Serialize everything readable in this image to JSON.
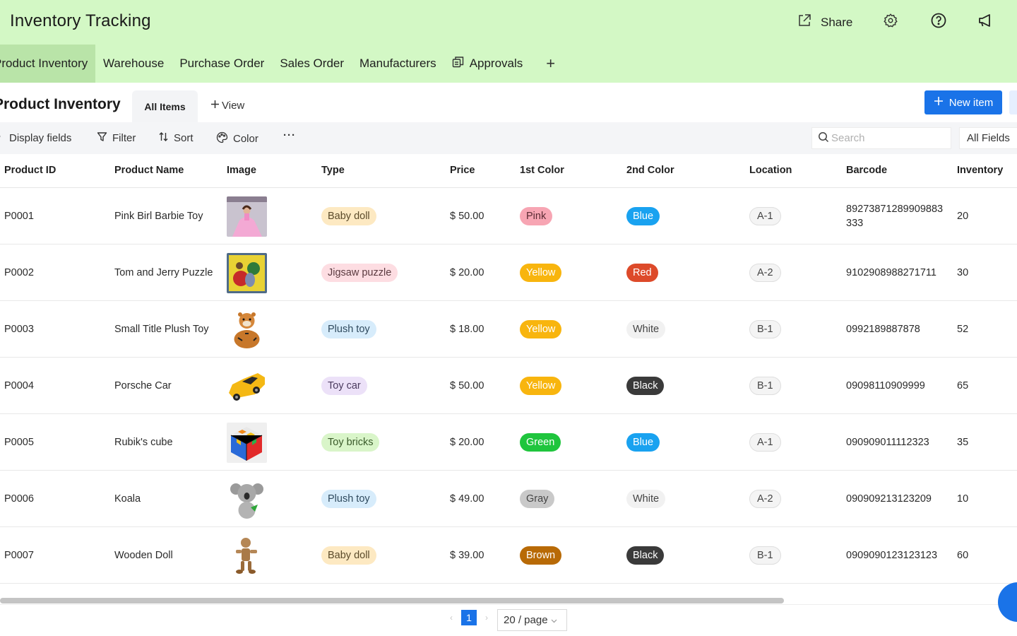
{
  "header": {
    "title": "Inventory Tracking",
    "share_label": "Share",
    "icons": [
      "share-icon",
      "gear-icon",
      "help-icon",
      "megaphone-icon"
    ]
  },
  "nav": {
    "tabs": [
      {
        "label": "Product Inventory",
        "active": true
      },
      {
        "label": "Warehouse"
      },
      {
        "label": "Purchase Order"
      },
      {
        "label": "Sales Order"
      },
      {
        "label": "Manufacturers"
      },
      {
        "label": "Approvals",
        "icon": "copy-icon"
      }
    ],
    "add_label": "+"
  },
  "view": {
    "title": "Product Inventory",
    "active_view": "All Items",
    "add_view_label": "View",
    "new_item_label": "New item"
  },
  "toolbar": {
    "display_fields": "Display fields",
    "filter": "Filter",
    "sort": "Sort",
    "color": "Color",
    "more": "···",
    "search_placeholder": "Search",
    "field_scope": "All Fields"
  },
  "table": {
    "columns": [
      "Product ID",
      "Product Name",
      "Image",
      "Type",
      "Price",
      "1st Color",
      "2nd Color",
      "Location",
      "Barcode",
      "Inventory"
    ],
    "rows": [
      {
        "id": "P0001",
        "name": "Pink Birl Barbie Toy",
        "image": "doll-photo",
        "type": "Baby doll",
        "price": "$ 50.00",
        "color1": "Pink",
        "color2": "Blue",
        "location": "A-1",
        "barcode": "89273871289909883333",
        "inventory": "20"
      },
      {
        "id": "P0002",
        "name": "Tom and Jerry Puzzle",
        "image": "puzzle-photo",
        "type": "Jigsaw puzzle",
        "price": "$ 20.00",
        "color1": "Yellow",
        "color2": "Red",
        "location": "A-2",
        "barcode": "9102908988271711",
        "inventory": "30"
      },
      {
        "id": "P0003",
        "name": "Small Title Plush Toy",
        "image": "tiger-photo",
        "type": "Plush toy",
        "price": "$ 18.00",
        "color1": "Yellow",
        "color2": "White",
        "location": "B-1",
        "barcode": "0992189887878",
        "inventory": "52"
      },
      {
        "id": "P0004",
        "name": "Porsche Car",
        "image": "car-photo",
        "type": "Toy car",
        "price": "$ 50.00",
        "color1": "Yellow",
        "color2": "Black",
        "location": "B-1",
        "barcode": "09098110909999",
        "inventory": "65"
      },
      {
        "id": "P0005",
        "name": "Rubik's cube",
        "image": "cube-photo",
        "type": "Toy bricks",
        "price": "$ 20.00",
        "color1": "Green",
        "color2": "Blue",
        "location": "A-1",
        "barcode": "090909011112323",
        "inventory": "35"
      },
      {
        "id": "P0006",
        "name": "Koala",
        "image": "koala-photo",
        "type": "Plush toy",
        "price": "$ 49.00",
        "color1": "Gray",
        "color2": "White",
        "location": "A-2",
        "barcode": "090909213123209",
        "inventory": "10"
      },
      {
        "id": "P0007",
        "name": "Wooden Doll",
        "image": "wooden-doll-photo",
        "type": "Baby doll",
        "price": "$ 39.00",
        "color1": "Brown",
        "color2": "Black",
        "location": "B-1",
        "barcode": "0909090123123123",
        "inventory": "60"
      }
    ]
  },
  "type_colors": {
    "Baby doll": {
      "bg": "#fde9c2",
      "fg": "#5a4a2a"
    },
    "Jigsaw puzzle": {
      "bg": "#fddde2",
      "fg": "#5a3a40"
    },
    "Plush toy": {
      "bg": "#d7ecfb",
      "fg": "#2f4a5e"
    },
    "Toy car": {
      "bg": "#ece1f8",
      "fg": "#4a3a5e"
    },
    "Toy bricks": {
      "bg": "#d9f5c9",
      "fg": "#3a5a2a"
    }
  },
  "color_tags": {
    "Pink": {
      "bg": "#f7a5b3",
      "fg": "#5a2a33"
    },
    "Blue": {
      "bg": "#19a2f0",
      "fg": "#ffffff"
    },
    "Yellow": {
      "bg": "#f8b50e",
      "fg": "#ffffff"
    },
    "Red": {
      "bg": "#dd4a2a",
      "fg": "#ffffff"
    },
    "White": {
      "bg": "#f1f1f1",
      "fg": "#444444"
    },
    "Black": {
      "bg": "#3a3a3a",
      "fg": "#ffffff"
    },
    "Green": {
      "bg": "#1fc53d",
      "fg": "#ffffff"
    },
    "Gray": {
      "bg": "#c9c9c9",
      "fg": "#444444"
    },
    "Brown": {
      "bg": "#b86a06",
      "fg": "#ffffff"
    }
  },
  "pagination": {
    "current_page": "1",
    "page_size": "20 / page"
  }
}
